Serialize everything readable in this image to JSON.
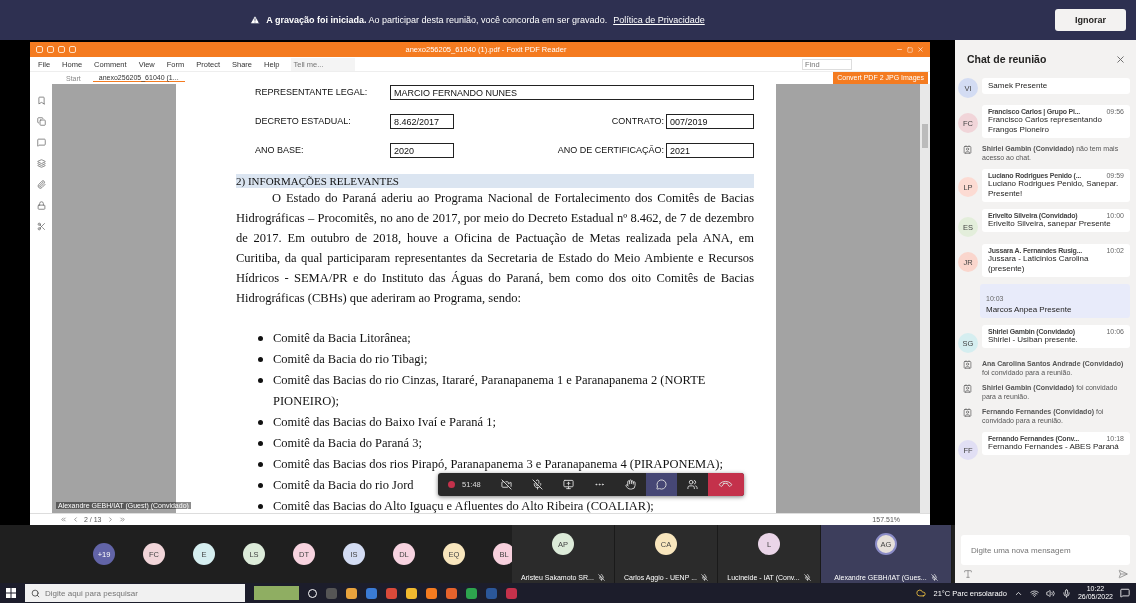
{
  "banner": {
    "message": "**A gravação foi iniciada.** Ao participar desta reunião, você concorda em ser gravado.",
    "link": "Política de Privacidade",
    "button": "Ignorar"
  },
  "pdf_viewer": {
    "title": "anexo256205_61040 (1).pdf - Foxit PDF Reader",
    "menu": [
      "File",
      "Home",
      "Comment",
      "View",
      "Form",
      "Protect",
      "Share",
      "Help"
    ],
    "tell_me": {
      "placeholder": "Tell me..."
    },
    "find": {
      "placeholder": "Find"
    },
    "promo": "Convert PDF 2 JPG Images",
    "tabs": [
      {
        "label": "Start",
        "selected": false
      },
      {
        "label": "anexo256205_61040 (1...",
        "selected": true
      }
    ],
    "form_rows": [
      [
        {
          "label": "REPRESENTANTE LEGAL:",
          "value": "MARCIO FERNANDO NUNES"
        }
      ],
      [
        {
          "label": "DECRETO ESTADUAL:",
          "value": "8.462/2017"
        },
        {
          "label": "CONTRATO:",
          "value": "007/2019"
        }
      ],
      [
        {
          "label": "ANO BASE:",
          "value": "2020"
        },
        {
          "label": "ANO DE CERTIFICAÇÃO:",
          "value": "2021"
        }
      ]
    ],
    "section_title": "2) INFORMAÇÕES RELEVANTES",
    "paragraph": "O Estado do Paraná aderiu ao Programa Nacional de Fortalecimento dos Comitês de Bacias Hidrográficas – Procomitês, no ano de 2017, por meio do Decreto Estadual nº 8.462, de 7 de dezembro de 2017. Em outubro de 2018, houve a Oficina de Pactuação de Metas realizada pela ANA, em Curitiba, da qual participaram representantes da Secretaria de Estado do Meio Ambiente e Recursos Hídricos - SEMA/PR e do Instituto das Águas do Paraná, bem como dos oito Comitês de Bacias Hidrográficas (CBHs) que aderiram ao Programa, sendo:",
    "bullets": [
      "Comitê da Bacia Litorânea;",
      "Comitê da Bacia do rio Tibagi;",
      "Comitê das Bacias do rio Cinzas, Itararé, Paranapanema 1 e Paranapanema 2 (NORTE PIONEIRO);",
      "Comitê das Bacias do Baixo Ivaí e Paraná 1;",
      "Comitê da Bacia do Paraná 3;",
      "Comitê das Bacias dos rios Pirapó, Paranapanema 3 e Paranapanema 4 (PIRAPONEMA);",
      "Comitê da Bacia do rio Jord",
      "Comitê das Bacias do Alto Iguaçu e Afluentes do Alto Ribeira (COALIAR);"
    ],
    "page_indicator": "2 / 13",
    "zoom": "157.51%"
  },
  "presenter_label": "Alexandre GEBH/IAT (Guest) (Convidado)",
  "call_controls": {
    "timer": "51:48",
    "recording": true,
    "buttons": [
      {
        "kind": "camera",
        "selected": false
      },
      {
        "kind": "mic",
        "selected": false
      },
      {
        "kind": "share",
        "selected": false
      },
      {
        "kind": "more",
        "selected": false
      },
      {
        "kind": "hand",
        "selected": false
      },
      {
        "kind": "chat",
        "selected": true
      },
      {
        "kind": "people",
        "selected": false
      },
      {
        "kind": "hangup",
        "selected": false
      }
    ]
  },
  "participants": [
    {
      "initials": "+19",
      "color": "#6264a7"
    },
    {
      "initials": "FC",
      "color": "#f1d5d9"
    },
    {
      "initials": "E",
      "color": "#d5eef0"
    },
    {
      "initials": "LS",
      "color": "#dcebd9"
    },
    {
      "initials": "DT",
      "color": "#f7d3df"
    },
    {
      "initials": "IS",
      "color": "#d3dcf3"
    },
    {
      "initials": "DL",
      "color": "#f7d3e0"
    },
    {
      "initials": "EQ",
      "color": "#f8e6bd"
    },
    {
      "initials": "BL",
      "color": "#f7d0dd"
    }
  ],
  "video_tiles": [
    {
      "initials": "AP",
      "name": "Aristeu Sakamoto SR...",
      "color": "#dcebd9",
      "speaking": false
    },
    {
      "initials": "CA",
      "name": "Carlos Aggio - UENP ...",
      "color": "#f8e6bd",
      "speaking": false
    },
    {
      "initials": "L",
      "name": "Lucineide - IAT (Conv...",
      "color": "#ead5e8",
      "speaking": false
    },
    {
      "initials": "AG",
      "name": "Alexandre GEBH/IAT (Gues...",
      "color": "#e6e0da",
      "speaking": true
    }
  ],
  "chat": {
    "title": "Chat de reunião",
    "messages": [
      {
        "kind": "partial",
        "initials": "VI",
        "color": "#d3dcf3",
        "text": "Samek Presente"
      },
      {
        "kind": "message",
        "initials": "FC",
        "color": "#f1d5d9",
        "sender": "Francisco Carlos | Grupo Pi...",
        "time": "09:56",
        "text": "Francisco Carlos representando Frangos Pioneiro"
      },
      {
        "kind": "system",
        "text": "**Shirlei Gambin (Convidado)** não tem mais acesso ao chat."
      },
      {
        "kind": "message",
        "initials": "LP",
        "color": "#fcdbd3",
        "sender": "Luciano Rodrigues Penido (...",
        "time": "09:59",
        "text": "Luciano Rodrigues Penido, Sanepar. Presente!"
      },
      {
        "kind": "message",
        "initials": "ES",
        "color": "#e3eedb",
        "sender": "Erivelto Silveira (Convidado)",
        "time": "10:00",
        "text": "Erivelto Silveira, sanepar Presente"
      },
      {
        "kind": "message",
        "initials": "JR",
        "color": "#fad6cd",
        "sender": "Jussara A. Fernandes Rusig...",
        "time": "10:02",
        "text": "Jussara - Laticinios Carolina (presente)"
      },
      {
        "kind": "own",
        "time": "10:03",
        "text": "Marcos Anpea Presente"
      },
      {
        "kind": "message",
        "initials": "SG",
        "color": "#d5eef0",
        "sender": "Shirlei Gambin (Convidado)",
        "time": "10:06",
        "text": "Shirlei - Usiban presente."
      },
      {
        "kind": "system",
        "text": "**Ana Carolina Santos Andrade (Convidado)** foi convidado para a reunião."
      },
      {
        "kind": "system",
        "text": "**Shirlei Gambin (Convidado)** foi convidado para a reunião."
      },
      {
        "kind": "system",
        "text": "**Fernando Fernandes (Convidado)** foi convidado para a reunião."
      },
      {
        "kind": "message",
        "initials": "FF",
        "color": "#e1dff4",
        "sender": "Fernando Fernandes (Conv...",
        "time": "10:18",
        "text": "Fernando Fernandes - ABES Paraná"
      }
    ],
    "input": {
      "placeholder": "Digite uma nova mensagem"
    }
  },
  "taskbar": {
    "search": {
      "placeholder": "Digite aqui para pesquisar"
    },
    "weather": "21°C Parc ensolarado",
    "time": "10:22",
    "date": "26/05/2022"
  }
}
